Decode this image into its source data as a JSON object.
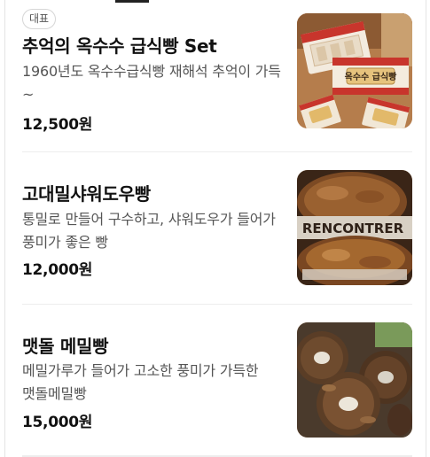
{
  "menu": {
    "items": [
      {
        "badge": "대표",
        "title": "추억의 옥수수 급식빵 Set",
        "description": "1960년도 옥수수급식빵 재해석 추억이 가득~",
        "price": "12,500원",
        "box_label": "옥수수 급식빵"
      },
      {
        "badge": "",
        "title": "고대밀샤워도우빵",
        "description": "통밀로 만들어 구수하고, 샤워도우가 들어가 풍미가 좋은 빵",
        "price": "12,000원",
        "bread_stamp": "RENCONTRER"
      },
      {
        "badge": "",
        "title": "맷돌 메밀빵",
        "description": "메밀가루가 들어가 고소한 풍미가 가득한 맷돌메밀빵",
        "price": "15,000원"
      }
    ]
  }
}
